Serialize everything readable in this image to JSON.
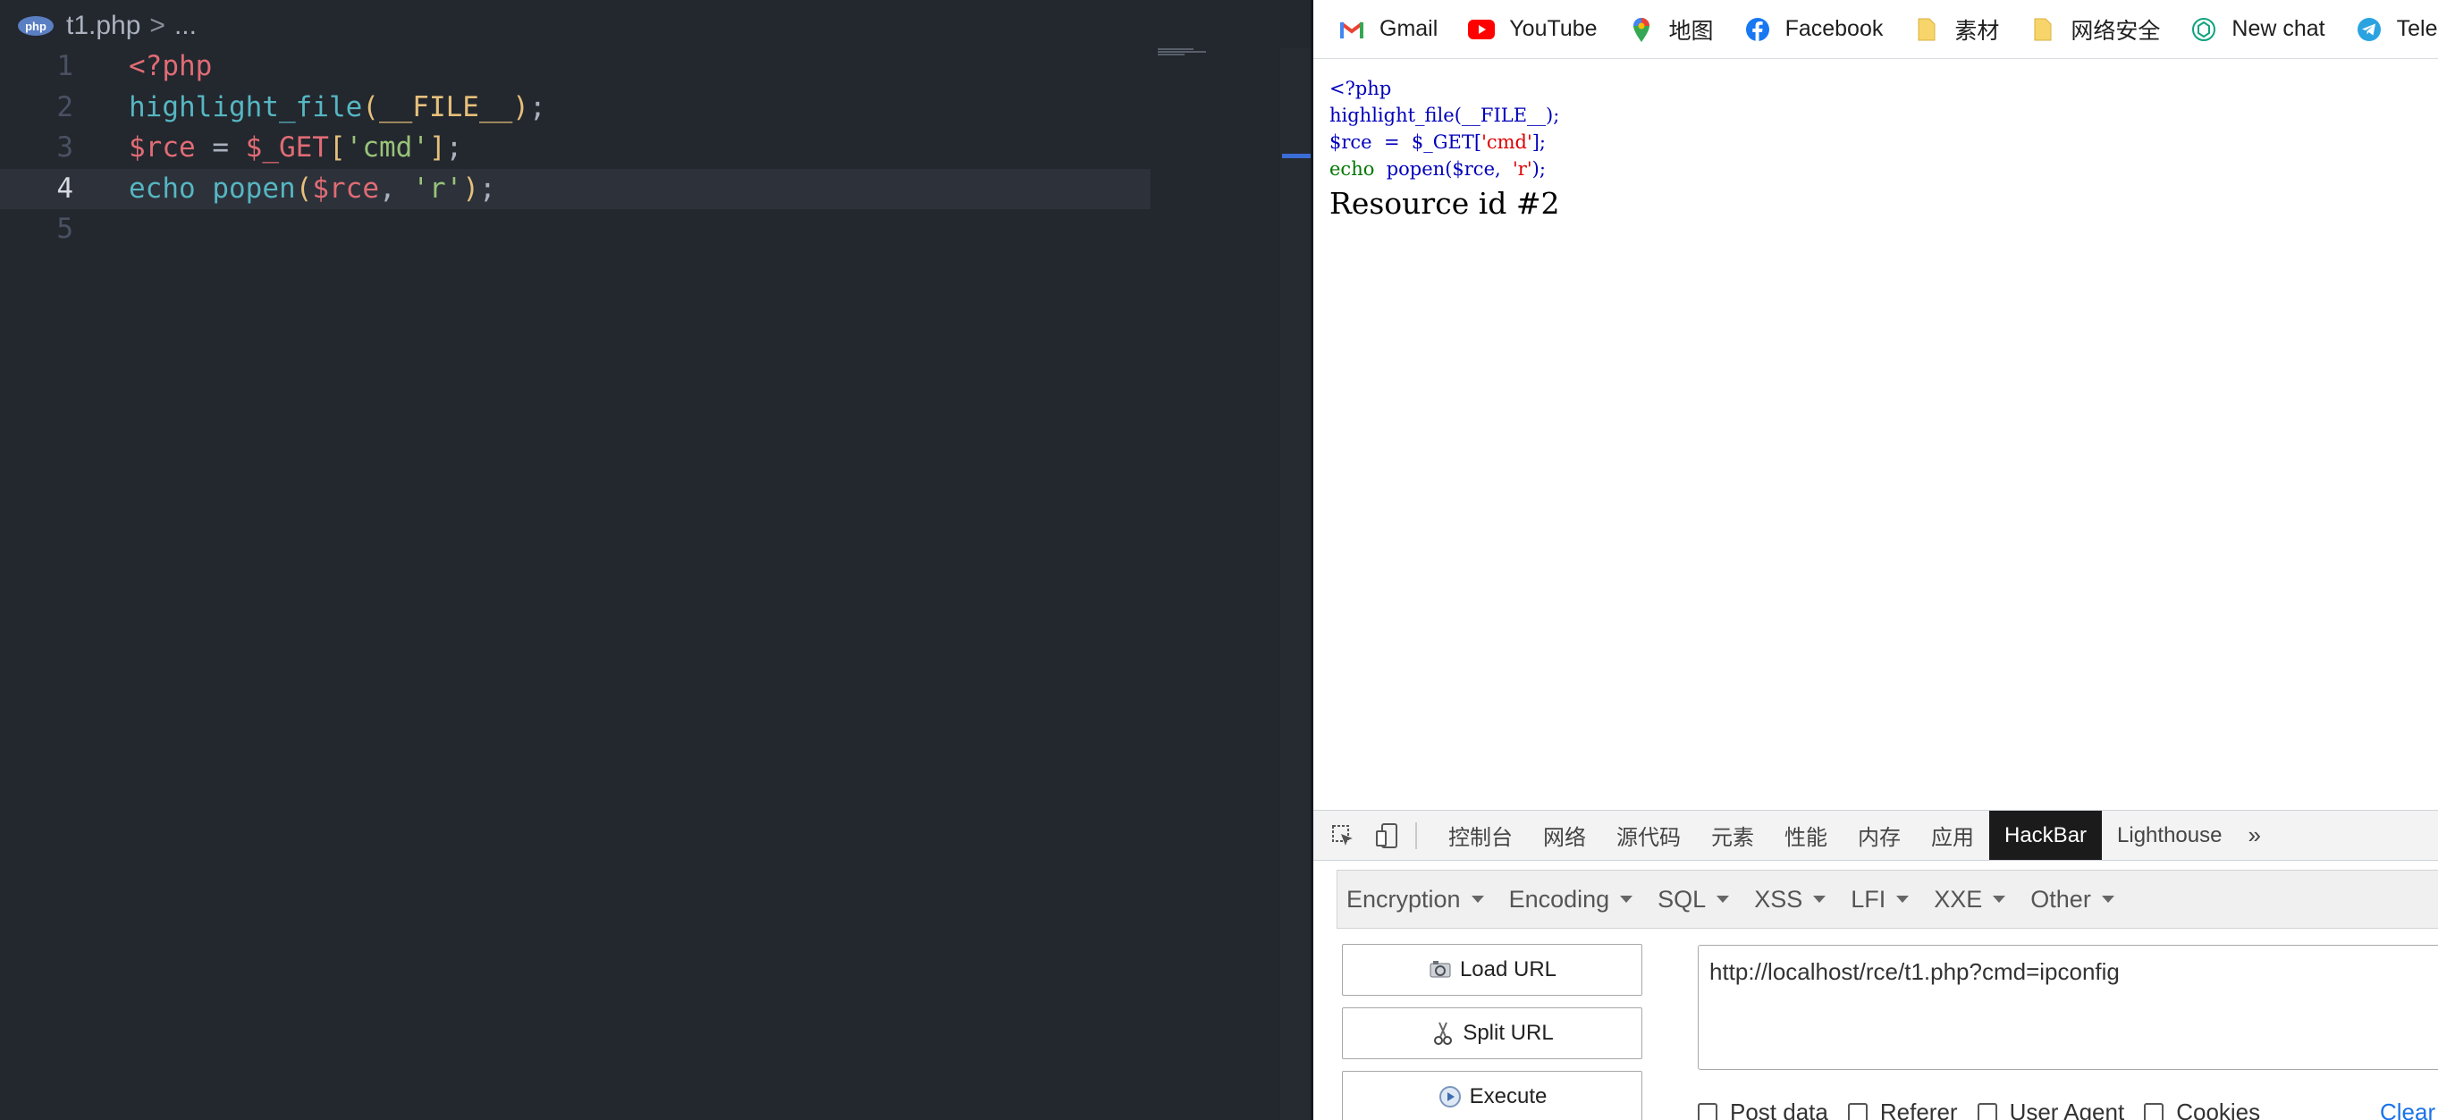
{
  "editor": {
    "breadcrumb": {
      "badge": "php",
      "file": "t1.php",
      "sep": ">",
      "more": "..."
    },
    "lines": [
      {
        "num": "1",
        "tokens": [
          {
            "t": "<?php",
            "c": "tag"
          }
        ]
      },
      {
        "num": "2",
        "tokens": [
          {
            "t": "highlight_file",
            "c": "fn"
          },
          {
            "t": "(",
            "c": "p1"
          },
          {
            "t": "__FILE__",
            "c": "p1"
          },
          {
            "t": ")",
            "c": "p1"
          },
          {
            "t": ";",
            "c": "punc"
          }
        ]
      },
      {
        "num": "3",
        "tokens": [
          {
            "t": "$rce",
            "c": "var"
          },
          {
            "t": " = ",
            "c": "punc"
          },
          {
            "t": "$_GET",
            "c": "var"
          },
          {
            "t": "[",
            "c": "p1"
          },
          {
            "t": "'cmd'",
            "c": "str"
          },
          {
            "t": "]",
            "c": "p1"
          },
          {
            "t": ";",
            "c": "punc"
          }
        ]
      },
      {
        "num": "4",
        "active": true,
        "tokens": [
          {
            "t": "echo",
            "c": "kw"
          },
          {
            "t": " ",
            "c": "punc"
          },
          {
            "t": "popen",
            "c": "fn"
          },
          {
            "t": "(",
            "c": "p1"
          },
          {
            "t": "$rce",
            "c": "var"
          },
          {
            "t": ", ",
            "c": "punc"
          },
          {
            "t": "'r'",
            "c": "str"
          },
          {
            "t": ")",
            "c": "p1"
          },
          {
            "t": ";",
            "c": "punc"
          }
        ]
      },
      {
        "num": "5",
        "tokens": []
      }
    ]
  },
  "browser": {
    "bookmarks": [
      {
        "label": "Gmail",
        "icon": "gmail-icon"
      },
      {
        "label": "YouTube",
        "icon": "youtube-icon"
      },
      {
        "label": "地图",
        "icon": "maps-icon"
      },
      {
        "label": "Facebook",
        "icon": "facebook-icon"
      },
      {
        "label": "素材",
        "icon": "folder-icon"
      },
      {
        "label": "网络安全",
        "icon": "folder-icon"
      },
      {
        "label": "New chat",
        "icon": "chatgpt-icon"
      },
      {
        "label": "Tele",
        "icon": "telegram-icon"
      }
    ],
    "source_lines": [
      [
        {
          "t": "<?php",
          "c": "def"
        }
      ],
      [
        {
          "t": "highlight_file(__FILE__);",
          "c": "def"
        }
      ],
      [
        {
          "t": "$rce  =  $_GET[",
          "c": "def"
        },
        {
          "t": "'cmd'",
          "c": "str"
        },
        {
          "t": "];",
          "c": "def"
        }
      ],
      [
        {
          "t": "echo  ",
          "c": "kw"
        },
        {
          "t": "popen(",
          "c": "def"
        },
        {
          "t": "$rce,  ",
          "c": "def"
        },
        {
          "t": "'r'",
          "c": "str"
        },
        {
          "t": ");",
          "c": "def"
        }
      ]
    ],
    "output": "Resource id #2",
    "devtools": {
      "tabs": [
        {
          "label": "控制台"
        },
        {
          "label": "网络"
        },
        {
          "label": "源代码"
        },
        {
          "label": "元素"
        },
        {
          "label": "性能"
        },
        {
          "label": "内存"
        },
        {
          "label": "应用"
        },
        {
          "label": "HackBar",
          "active": true
        },
        {
          "label": "Lighthouse"
        }
      ],
      "more": "»"
    },
    "hackbar": {
      "menus": [
        "Encryption",
        "Encoding",
        "SQL",
        "XSS",
        "LFI",
        "XXE",
        "Other"
      ],
      "buttons": {
        "load": "Load URL",
        "split": "Split URL",
        "execute": "Execute"
      },
      "url": "http://localhost/rce/t1.php?cmd=ipconfig",
      "options": [
        "Post data",
        "Referer",
        "User Agent",
        "Cookies"
      ],
      "clear": "Clear"
    }
  }
}
